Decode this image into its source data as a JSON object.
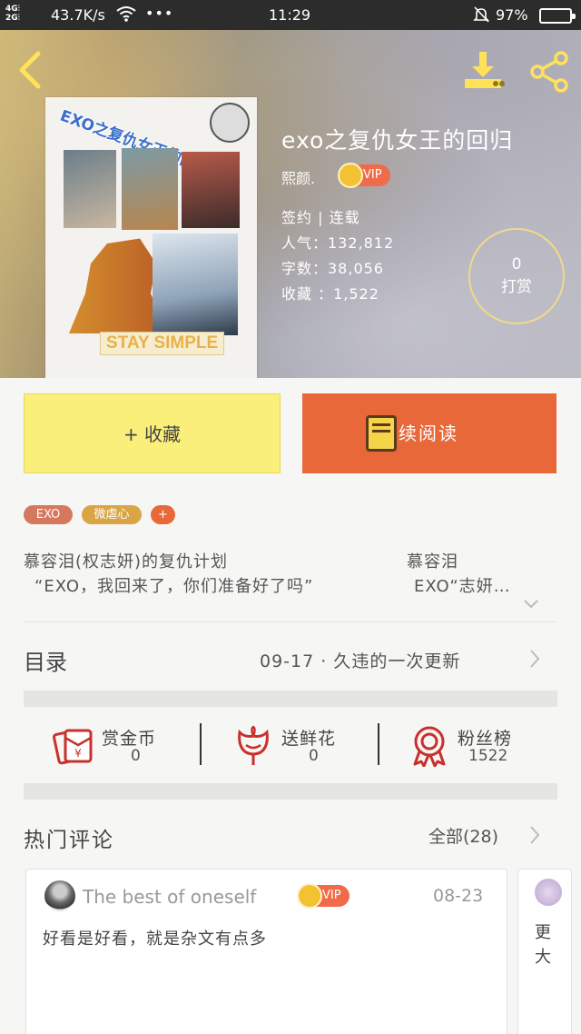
{
  "status_bar": {
    "signal": "4G\n2G",
    "net_speed": "43.7K/s",
    "more": "•••",
    "time": "11:29",
    "battery_pct": "97%"
  },
  "book": {
    "title": "exo之复仇女王的回归",
    "author": "熙颜.",
    "vip_label": "VIP",
    "status": "签约 | 连载",
    "popularity": "人气：132,812",
    "word_count": "字数：38,056",
    "favorites": "收藏 ：1,522",
    "reward_count": "0",
    "reward_label": "打赏",
    "cover_title": "EXO之复仇女王的回归",
    "cover_caption": "STAY SIMPLE"
  },
  "actions": {
    "collect_label": "+ 收藏",
    "read_label": "继续阅读"
  },
  "tags": [
    {
      "label": "EXO",
      "color": "#d5785e"
    },
    {
      "label": "微虐心",
      "color": "#d9a545"
    },
    {
      "label": "+",
      "color": "#e8683a"
    }
  ],
  "synopsis": {
    "line1_left": "慕容泪(权志妍)的复仇计划",
    "line1_right": "慕容泪",
    "line2_left": "“EXO，我回来了，你们准备好了吗”",
    "line2_right": "EXO“志妍…"
  },
  "catalog": {
    "label": "目录",
    "latest": "09-17 · 久违的一次更新"
  },
  "stats": [
    {
      "label": "赏金币",
      "value": "0",
      "icon": "red-envelope-icon"
    },
    {
      "label": "送鲜花",
      "value": "0",
      "icon": "flower-icon"
    },
    {
      "label": "粉丝榜",
      "value": "1522",
      "icon": "medal-icon"
    }
  ],
  "comments": {
    "title": "热门评论",
    "all_label": "全部(28)",
    "items": [
      {
        "user": "The best of oneself",
        "vip": "VIP",
        "date": "08-23",
        "text": "好看是好看，就是杂文有点多"
      },
      {
        "text": "更大"
      }
    ]
  },
  "colors": {
    "accent_orange": "#e8683a",
    "collect_yellow": "#fbef7b",
    "icon_red": "#c9302c"
  }
}
